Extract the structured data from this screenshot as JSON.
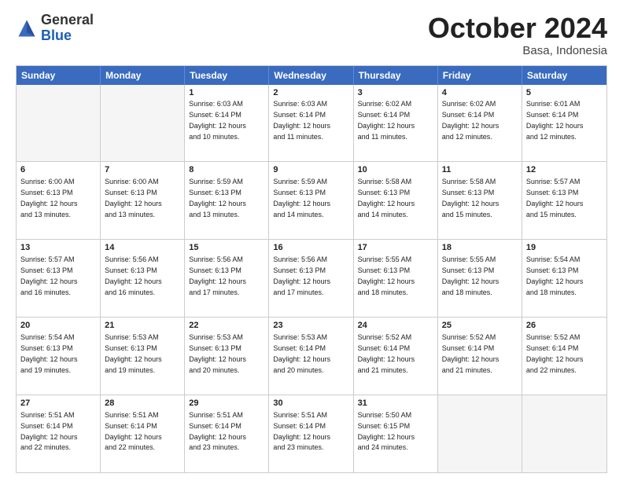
{
  "logo": {
    "general": "General",
    "blue": "Blue"
  },
  "header": {
    "month": "October 2024",
    "location": "Basa, Indonesia"
  },
  "weekdays": [
    "Sunday",
    "Monday",
    "Tuesday",
    "Wednesday",
    "Thursday",
    "Friday",
    "Saturday"
  ],
  "weeks": [
    [
      {
        "day": "",
        "info": ""
      },
      {
        "day": "",
        "info": ""
      },
      {
        "day": "1",
        "info": "Sunrise: 6:03 AM\nSunset: 6:14 PM\nDaylight: 12 hours\nand 10 minutes."
      },
      {
        "day": "2",
        "info": "Sunrise: 6:03 AM\nSunset: 6:14 PM\nDaylight: 12 hours\nand 11 minutes."
      },
      {
        "day": "3",
        "info": "Sunrise: 6:02 AM\nSunset: 6:14 PM\nDaylight: 12 hours\nand 11 minutes."
      },
      {
        "day": "4",
        "info": "Sunrise: 6:02 AM\nSunset: 6:14 PM\nDaylight: 12 hours\nand 12 minutes."
      },
      {
        "day": "5",
        "info": "Sunrise: 6:01 AM\nSunset: 6:14 PM\nDaylight: 12 hours\nand 12 minutes."
      }
    ],
    [
      {
        "day": "6",
        "info": "Sunrise: 6:00 AM\nSunset: 6:13 PM\nDaylight: 12 hours\nand 13 minutes."
      },
      {
        "day": "7",
        "info": "Sunrise: 6:00 AM\nSunset: 6:13 PM\nDaylight: 12 hours\nand 13 minutes."
      },
      {
        "day": "8",
        "info": "Sunrise: 5:59 AM\nSunset: 6:13 PM\nDaylight: 12 hours\nand 13 minutes."
      },
      {
        "day": "9",
        "info": "Sunrise: 5:59 AM\nSunset: 6:13 PM\nDaylight: 12 hours\nand 14 minutes."
      },
      {
        "day": "10",
        "info": "Sunrise: 5:58 AM\nSunset: 6:13 PM\nDaylight: 12 hours\nand 14 minutes."
      },
      {
        "day": "11",
        "info": "Sunrise: 5:58 AM\nSunset: 6:13 PM\nDaylight: 12 hours\nand 15 minutes."
      },
      {
        "day": "12",
        "info": "Sunrise: 5:57 AM\nSunset: 6:13 PM\nDaylight: 12 hours\nand 15 minutes."
      }
    ],
    [
      {
        "day": "13",
        "info": "Sunrise: 5:57 AM\nSunset: 6:13 PM\nDaylight: 12 hours\nand 16 minutes."
      },
      {
        "day": "14",
        "info": "Sunrise: 5:56 AM\nSunset: 6:13 PM\nDaylight: 12 hours\nand 16 minutes."
      },
      {
        "day": "15",
        "info": "Sunrise: 5:56 AM\nSunset: 6:13 PM\nDaylight: 12 hours\nand 17 minutes."
      },
      {
        "day": "16",
        "info": "Sunrise: 5:56 AM\nSunset: 6:13 PM\nDaylight: 12 hours\nand 17 minutes."
      },
      {
        "day": "17",
        "info": "Sunrise: 5:55 AM\nSunset: 6:13 PM\nDaylight: 12 hours\nand 18 minutes."
      },
      {
        "day": "18",
        "info": "Sunrise: 5:55 AM\nSunset: 6:13 PM\nDaylight: 12 hours\nand 18 minutes."
      },
      {
        "day": "19",
        "info": "Sunrise: 5:54 AM\nSunset: 6:13 PM\nDaylight: 12 hours\nand 18 minutes."
      }
    ],
    [
      {
        "day": "20",
        "info": "Sunrise: 5:54 AM\nSunset: 6:13 PM\nDaylight: 12 hours\nand 19 minutes."
      },
      {
        "day": "21",
        "info": "Sunrise: 5:53 AM\nSunset: 6:13 PM\nDaylight: 12 hours\nand 19 minutes."
      },
      {
        "day": "22",
        "info": "Sunrise: 5:53 AM\nSunset: 6:13 PM\nDaylight: 12 hours\nand 20 minutes."
      },
      {
        "day": "23",
        "info": "Sunrise: 5:53 AM\nSunset: 6:14 PM\nDaylight: 12 hours\nand 20 minutes."
      },
      {
        "day": "24",
        "info": "Sunrise: 5:52 AM\nSunset: 6:14 PM\nDaylight: 12 hours\nand 21 minutes."
      },
      {
        "day": "25",
        "info": "Sunrise: 5:52 AM\nSunset: 6:14 PM\nDaylight: 12 hours\nand 21 minutes."
      },
      {
        "day": "26",
        "info": "Sunrise: 5:52 AM\nSunset: 6:14 PM\nDaylight: 12 hours\nand 22 minutes."
      }
    ],
    [
      {
        "day": "27",
        "info": "Sunrise: 5:51 AM\nSunset: 6:14 PM\nDaylight: 12 hours\nand 22 minutes."
      },
      {
        "day": "28",
        "info": "Sunrise: 5:51 AM\nSunset: 6:14 PM\nDaylight: 12 hours\nand 22 minutes."
      },
      {
        "day": "29",
        "info": "Sunrise: 5:51 AM\nSunset: 6:14 PM\nDaylight: 12 hours\nand 23 minutes."
      },
      {
        "day": "30",
        "info": "Sunrise: 5:51 AM\nSunset: 6:14 PM\nDaylight: 12 hours\nand 23 minutes."
      },
      {
        "day": "31",
        "info": "Sunrise: 5:50 AM\nSunset: 6:15 PM\nDaylight: 12 hours\nand 24 minutes."
      },
      {
        "day": "",
        "info": ""
      },
      {
        "day": "",
        "info": ""
      }
    ]
  ]
}
